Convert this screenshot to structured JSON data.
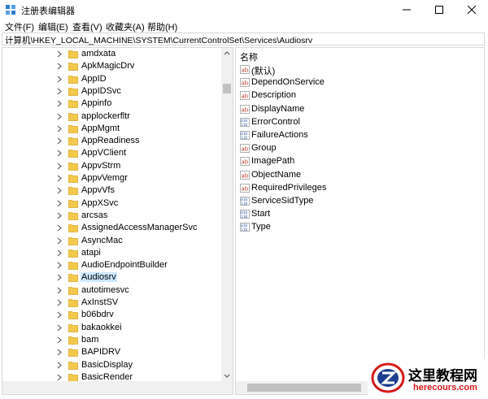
{
  "window": {
    "title": "注册表编辑器",
    "minimize_label": "minimize",
    "maximize_label": "maximize",
    "close_label": "close"
  },
  "menu": {
    "file": "文件(F)",
    "edit": "编辑(E)",
    "view": "查看(V)",
    "favorites": "收藏夹(A)",
    "help": "帮助(H)"
  },
  "address": {
    "path": "计算机\\HKEY_LOCAL_MACHINE\\SYSTEM\\CurrentControlSet\\Services\\Audiosrv"
  },
  "tree": {
    "items": [
      {
        "label": "amdxata",
        "selected": false
      },
      {
        "label": "ApkMagicDrv",
        "selected": false
      },
      {
        "label": "AppID",
        "selected": false
      },
      {
        "label": "AppIDSvc",
        "selected": false
      },
      {
        "label": "Appinfo",
        "selected": false
      },
      {
        "label": "applockerfltr",
        "selected": false
      },
      {
        "label": "AppMgmt",
        "selected": false
      },
      {
        "label": "AppReadiness",
        "selected": false
      },
      {
        "label": "AppVClient",
        "selected": false
      },
      {
        "label": "AppvStrm",
        "selected": false
      },
      {
        "label": "AppvVemgr",
        "selected": false
      },
      {
        "label": "AppvVfs",
        "selected": false
      },
      {
        "label": "AppXSvc",
        "selected": false
      },
      {
        "label": "arcsas",
        "selected": false
      },
      {
        "label": "AssignedAccessManagerSvc",
        "selected": false
      },
      {
        "label": "AsyncMac",
        "selected": false
      },
      {
        "label": "atapi",
        "selected": false
      },
      {
        "label": "AudioEndpointBuilder",
        "selected": false
      },
      {
        "label": "Audiosrv",
        "selected": true
      },
      {
        "label": "autotimesvc",
        "selected": false
      },
      {
        "label": "AxInstSV",
        "selected": false
      },
      {
        "label": "b06bdrv",
        "selected": false
      },
      {
        "label": "bakaokkei",
        "selected": false
      },
      {
        "label": "bam",
        "selected": false
      },
      {
        "label": "BAPIDRV",
        "selected": false
      },
      {
        "label": "BasicDisplay",
        "selected": false
      },
      {
        "label": "BasicRender",
        "selected": false
      }
    ]
  },
  "values": {
    "column_name": "名称",
    "items": [
      {
        "name": "(默认)",
        "kind": "string"
      },
      {
        "name": "DependOnService",
        "kind": "string"
      },
      {
        "name": "Description",
        "kind": "string"
      },
      {
        "name": "DisplayName",
        "kind": "string"
      },
      {
        "name": "ErrorControl",
        "kind": "binary"
      },
      {
        "name": "FailureActions",
        "kind": "binary"
      },
      {
        "name": "Group",
        "kind": "string"
      },
      {
        "name": "ImagePath",
        "kind": "string"
      },
      {
        "name": "ObjectName",
        "kind": "string"
      },
      {
        "name": "RequiredPrivileges",
        "kind": "string"
      },
      {
        "name": "ServiceSidType",
        "kind": "binary"
      },
      {
        "name": "Start",
        "kind": "binary"
      },
      {
        "name": "Type",
        "kind": "binary"
      }
    ]
  },
  "watermark": {
    "title": "这里教程网",
    "url": "herecours.com"
  },
  "colors": {
    "selection": "#cce8ff",
    "folder": "#f2c94c",
    "string_icon": "#c0392b",
    "binary_icon": "#2f5fa7",
    "watermark_red": "#d71a1a"
  }
}
